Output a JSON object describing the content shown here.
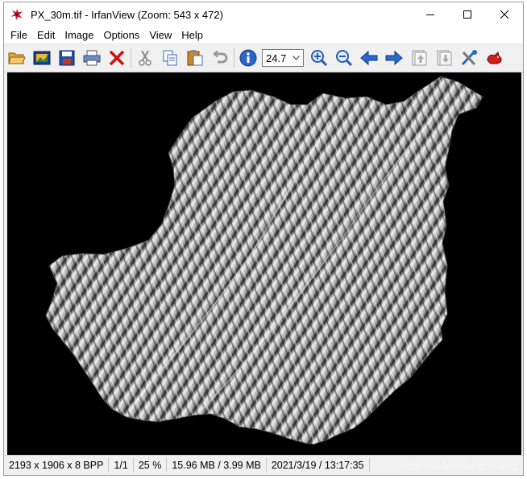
{
  "window": {
    "title": "PX_30m.tif - IrfanView (Zoom: 543 x 472)"
  },
  "menu": {
    "items": [
      "File",
      "Edit",
      "Image",
      "Options",
      "View",
      "Help"
    ]
  },
  "toolbar": {
    "zoom_value": "24.7",
    "icons": [
      "open-folder-icon",
      "slideshow-icon",
      "save-icon",
      "print-icon",
      "delete-icon",
      "cut-icon",
      "copy-icon",
      "paste-icon",
      "undo-icon",
      "info-icon",
      "zoom-in-icon",
      "zoom-out-icon",
      "prev-icon",
      "next-icon",
      "page-up-icon",
      "page-down-icon",
      "settings-icon",
      "irfanview-icon"
    ]
  },
  "status": {
    "dimensions": "2193 x 1906 x 8 BPP",
    "page": "1/1",
    "zoom_percent": "25 %",
    "memory": "15.96 MB / 3.99 MB",
    "timestamp": "2021/3/19 / 13:17:35"
  },
  "watermark": "csdn.net/lovefengruoqing",
  "colors": {
    "viewport_bg": "#000000",
    "chrome_bg": "#f0f0f0"
  }
}
